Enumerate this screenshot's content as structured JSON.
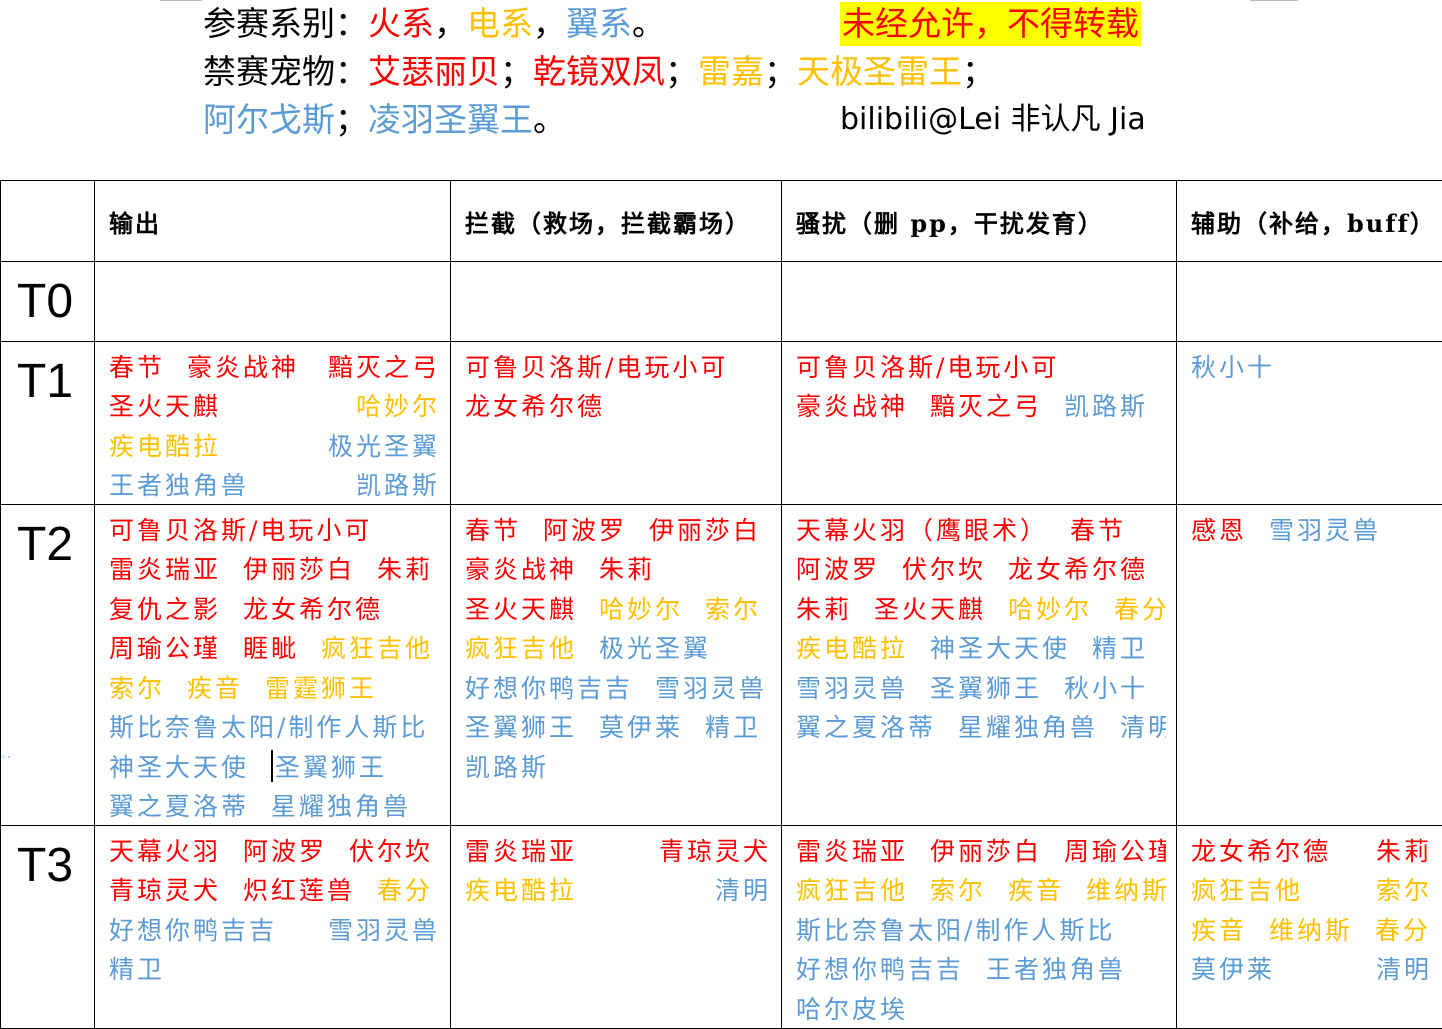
{
  "header": {
    "line1": [
      {
        "text": "参赛系别：",
        "color": "black"
      },
      {
        "text": "火系",
        "color": "red"
      },
      {
        "text": "，",
        "color": "black"
      },
      {
        "text": "电系",
        "color": "orange"
      },
      {
        "text": "，",
        "color": "black"
      },
      {
        "text": "翼系",
        "color": "blue"
      },
      {
        "text": "。",
        "color": "black"
      }
    ],
    "line2": [
      {
        "text": "禁赛宠物：",
        "color": "black"
      },
      {
        "text": "艾瑟丽贝",
        "color": "red"
      },
      {
        "text": "；",
        "color": "black"
      },
      {
        "text": "乾镜双凤",
        "color": "red"
      },
      {
        "text": "；",
        "color": "black"
      },
      {
        "text": "雷嘉",
        "color": "orange"
      },
      {
        "text": "；",
        "color": "black"
      },
      {
        "text": "天极圣雷王",
        "color": "orange"
      },
      {
        "text": "；",
        "color": "black"
      }
    ],
    "line3": [
      {
        "text": "阿尔戈斯",
        "color": "blue"
      },
      {
        "text": "；",
        "color": "black"
      },
      {
        "text": "凌羽圣翼王",
        "color": "blue"
      },
      {
        "text": "。",
        "color": "black"
      }
    ],
    "notice": "未经允许，不得转载",
    "credit": "bilibili@Lei 非认凡 Jia"
  },
  "colors": {
    "red": "#ff0000",
    "orange": "#ffc000",
    "blue": "#5b9bd5",
    "black": "#000000",
    "highlight": "#ffff00"
  },
  "table": {
    "columns": [
      "",
      "输出",
      "拦截（救场，拦截霸场）",
      "骚扰（删 pp，干扰发育）",
      "辅助（补给，buff）"
    ],
    "rows": [
      {
        "tier": "T0",
        "cells": [
          [],
          [],
          [],
          []
        ]
      },
      {
        "tier": "T1",
        "cells": [
          [
            [
              {
                "t": "春节",
                "c": "red"
              },
              {
                "t": "豪炎战神",
                "c": "red"
              },
              {
                "t": "黯灭之弓",
                "c": "red",
                "r": true
              }
            ],
            [
              {
                "t": "圣火天麒",
                "c": "red"
              },
              {
                "t": "哈妙尔",
                "c": "orange",
                "r": true
              }
            ],
            [
              {
                "t": "疾电酷拉",
                "c": "orange"
              },
              {
                "t": "极光圣翼",
                "c": "blue",
                "r": true
              }
            ],
            [
              {
                "t": "王者独角兽",
                "c": "blue"
              },
              {
                "t": "凯路斯",
                "c": "blue",
                "r": true
              }
            ]
          ],
          [
            [
              {
                "t": "可鲁贝洛斯/电玩小可",
                "c": "red"
              }
            ],
            [
              {
                "t": "龙女希尔德",
                "c": "red"
              }
            ]
          ],
          [
            [
              {
                "t": "可鲁贝洛斯/电玩小可",
                "c": "red"
              }
            ],
            [
              {
                "t": "豪炎战神",
                "c": "red"
              },
              {
                "t": "黯灭之弓",
                "c": "red"
              },
              {
                "t": "凯路斯",
                "c": "blue"
              }
            ]
          ],
          [
            [
              {
                "t": "秋小十",
                "c": "blue"
              }
            ]
          ]
        ]
      },
      {
        "tier": "T2",
        "cells": [
          [
            [
              {
                "t": "可鲁贝洛斯/电玩小可",
                "c": "red"
              }
            ],
            [
              {
                "t": "雷炎瑞亚",
                "c": "red"
              },
              {
                "t": "伊丽莎白",
                "c": "red"
              },
              {
                "t": "朱莉",
                "c": "red"
              }
            ],
            [
              {
                "t": "复仇之影",
                "c": "red"
              },
              {
                "t": "龙女希尔德",
                "c": "red"
              }
            ],
            [
              {
                "t": "周瑜公瑾",
                "c": "red"
              },
              {
                "t": "睚眦",
                "c": "red"
              },
              {
                "t": "疯狂吉他",
                "c": "orange"
              }
            ],
            [
              {
                "t": "索尔",
                "c": "orange"
              },
              {
                "t": "疾音",
                "c": "orange"
              },
              {
                "t": "雷霆狮王",
                "c": "orange"
              }
            ],
            [
              {
                "t": "斯比奈鲁太阳/制作人斯比",
                "c": "blue"
              }
            ],
            [
              {
                "t": "神圣大天使",
                "c": "blue"
              },
              {
                "t": "圣翼狮王",
                "c": "blue",
                "cursor": true
              }
            ],
            [
              {
                "t": "翼之夏洛蒂",
                "c": "blue"
              },
              {
                "t": "星耀独角兽",
                "c": "blue"
              }
            ]
          ],
          [
            [
              {
                "t": "春节",
                "c": "red"
              },
              {
                "t": "阿波罗",
                "c": "red"
              },
              {
                "t": "伊丽莎白",
                "c": "red"
              }
            ],
            [
              {
                "t": "豪炎战神",
                "c": "red"
              },
              {
                "t": "朱莉",
                "c": "red"
              }
            ],
            [
              {
                "t": "圣火天麒",
                "c": "red"
              },
              {
                "t": "哈妙尔",
                "c": "orange"
              },
              {
                "t": "索尔",
                "c": "orange"
              }
            ],
            [
              {
                "t": "疯狂吉他",
                "c": "orange"
              },
              {
                "t": "极光圣翼",
                "c": "blue"
              }
            ],
            [
              {
                "t": "好想你鸭吉吉",
                "c": "blue"
              },
              {
                "t": "雪羽灵兽",
                "c": "blue"
              }
            ],
            [
              {
                "t": "圣翼狮王",
                "c": "blue"
              },
              {
                "t": "莫伊莱",
                "c": "blue"
              },
              {
                "t": "精卫",
                "c": "blue"
              }
            ],
            [
              {
                "t": "凯路斯",
                "c": "blue"
              }
            ]
          ],
          [
            [
              {
                "t": "天幕火羽（鹰眼术）",
                "c": "red"
              },
              {
                "t": "春节",
                "c": "red"
              }
            ],
            [
              {
                "t": "阿波罗",
                "c": "red"
              },
              {
                "t": "伏尔坎",
                "c": "red"
              },
              {
                "t": "龙女希尔德",
                "c": "red"
              }
            ],
            [
              {
                "t": "朱莉",
                "c": "red"
              },
              {
                "t": "圣火天麒",
                "c": "red"
              },
              {
                "t": "哈妙尔",
                "c": "orange"
              },
              {
                "t": "春分",
                "c": "orange"
              }
            ],
            [
              {
                "t": "疾电酷拉",
                "c": "orange"
              },
              {
                "t": "神圣大天使",
                "c": "blue"
              },
              {
                "t": "精卫",
                "c": "blue"
              }
            ],
            [
              {
                "t": "雪羽灵兽",
                "c": "blue"
              },
              {
                "t": "圣翼狮王",
                "c": "blue"
              },
              {
                "t": "秋小十",
                "c": "blue"
              }
            ],
            [
              {
                "t": "翼之夏洛蒂",
                "c": "blue"
              },
              {
                "t": "星耀独角兽",
                "c": "blue"
              },
              {
                "t": "清明",
                "c": "blue"
              }
            ]
          ],
          [
            [
              {
                "t": "感恩",
                "c": "red"
              },
              {
                "t": "雪羽灵兽",
                "c": "blue"
              }
            ]
          ]
        ]
      },
      {
        "tier": "T3",
        "cells": [
          [
            [
              {
                "t": "天幕火羽",
                "c": "red"
              },
              {
                "t": "阿波罗",
                "c": "red"
              },
              {
                "t": "伏尔坎",
                "c": "red"
              }
            ],
            [
              {
                "t": "青琼灵犬",
                "c": "red"
              },
              {
                "t": "炽红莲兽",
                "c": "red"
              },
              {
                "t": "春分",
                "c": "orange"
              }
            ],
            [
              {
                "t": "好想你鸭吉吉",
                "c": "blue"
              },
              {
                "t": "雪羽灵兽",
                "c": "blue",
                "r": true
              }
            ],
            [
              {
                "t": "精卫",
                "c": "blue"
              }
            ]
          ],
          [
            [
              {
                "t": "雷炎瑞亚",
                "c": "red"
              },
              {
                "t": "青琼灵犬",
                "c": "red",
                "r": true
              }
            ],
            [
              {
                "t": "疾电酷拉",
                "c": "orange"
              },
              {
                "t": "清明",
                "c": "blue",
                "r": true
              }
            ]
          ],
          [
            [
              {
                "t": "雷炎瑞亚",
                "c": "red"
              },
              {
                "t": "伊丽莎白",
                "c": "red"
              },
              {
                "t": "周瑜公瑾",
                "c": "red"
              }
            ],
            [
              {
                "t": "疯狂吉他",
                "c": "orange"
              },
              {
                "t": "索尔",
                "c": "orange"
              },
              {
                "t": "疾音",
                "c": "orange"
              },
              {
                "t": "维纳斯",
                "c": "orange"
              }
            ],
            [
              {
                "t": "斯比奈鲁太阳/制作人斯比",
                "c": "blue"
              }
            ],
            [
              {
                "t": "好想你鸭吉吉",
                "c": "blue"
              },
              {
                "t": "王者独角兽",
                "c": "blue"
              }
            ],
            [
              {
                "t": "哈尔皮埃",
                "c": "blue"
              }
            ]
          ],
          [
            [
              {
                "t": "龙女希尔德",
                "c": "red"
              },
              {
                "t": "朱莉",
                "c": "red",
                "r": true
              }
            ],
            [
              {
                "t": "疯狂吉他",
                "c": "orange"
              },
              {
                "t": "索尔",
                "c": "orange",
                "r": true
              }
            ],
            [
              {
                "t": "疾音",
                "c": "orange"
              },
              {
                "t": "维纳斯",
                "c": "orange"
              },
              {
                "t": "春分",
                "c": "orange"
              }
            ],
            [
              {
                "t": "莫伊莱",
                "c": "blue"
              },
              {
                "t": "清明",
                "c": "blue",
                "r": true
              }
            ]
          ]
        ]
      }
    ]
  }
}
